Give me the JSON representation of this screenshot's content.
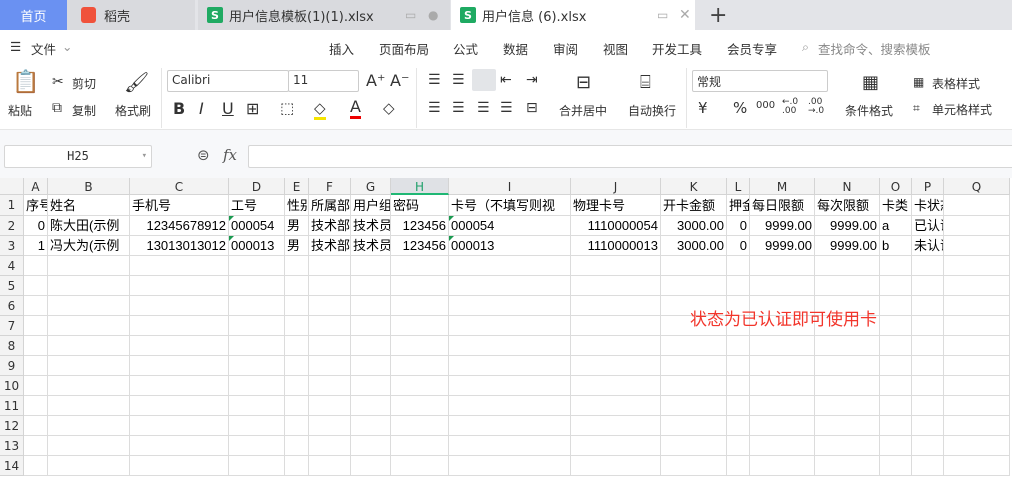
{
  "tabs": [
    {
      "label": "首页"
    },
    {
      "label": "稻壳"
    },
    {
      "label": "用户信息模板(1)(1).xlsx"
    },
    {
      "label": "用户信息 (6).xlsx"
    }
  ],
  "menu": {
    "file": "文件",
    "items": [
      "开始",
      "插入",
      "页面布局",
      "公式",
      "数据",
      "审阅",
      "视图",
      "开发工具",
      "会员专享"
    ],
    "search_placeholder": "查找命令、搜索模板"
  },
  "ribbon": {
    "paste": "粘贴",
    "cut": "剪切",
    "copy": "复制",
    "format_painter": "格式刷",
    "font": "Calibri",
    "font_size": "11",
    "merge": "合并居中",
    "wrap": "自动换行",
    "number_format": "常规",
    "cond_format": "条件格式",
    "table_style": "表格样式",
    "cell_style": "单元格样式"
  },
  "formula_bar": {
    "cell_ref": "H25",
    "fx": "fx",
    "value": ""
  },
  "sheet": {
    "columns": [
      "A",
      "B",
      "C",
      "D",
      "E",
      "F",
      "G",
      "H",
      "I",
      "J",
      "K",
      "L",
      "M",
      "N",
      "O",
      "P",
      "Q"
    ],
    "selected_column": "H",
    "row_numbers": [
      "1",
      "2",
      "3",
      "4",
      "5",
      "6",
      "7",
      "8",
      "9",
      "10",
      "11",
      "12",
      "13",
      "14"
    ],
    "rows": [
      [
        "序号",
        "姓名",
        "手机号",
        "工号",
        "性别",
        "所属部门",
        "用户组",
        "密码",
        "卡号（不填写则视",
        "物理卡号",
        "开卡金额",
        "押金",
        "每日限额",
        "每次限额",
        "卡类",
        "卡状态",
        ""
      ],
      [
        "0",
        "陈大田(示例",
        "12345678912",
        "000054",
        "男",
        "技术部",
        "技术员",
        "123456",
        "000054",
        "1110000054",
        "3000.00",
        "0",
        "9999.00",
        "9999.00",
        "a",
        "已认证",
        ""
      ],
      [
        "1",
        "冯大为(示例",
        "13013013012",
        "000013",
        "男",
        "技术部",
        "技术员",
        "123456",
        "000013",
        "1110000013",
        "3000.00",
        "0",
        "9999.00",
        "9999.00",
        "b",
        "未认证",
        ""
      ]
    ]
  },
  "annotation": "状态为已认证即可使用卡",
  "colors": {
    "accent": "#1fb774",
    "home_tab": "#6a91f2",
    "annotation": "#f2352b"
  }
}
